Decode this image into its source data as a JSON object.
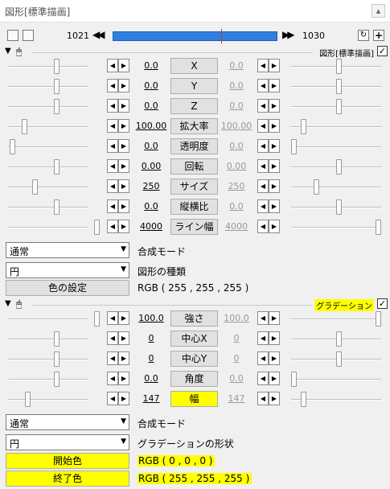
{
  "window": {
    "title": "図形[標準描画]",
    "close_glyph": "▴"
  },
  "toolbar": {
    "frame_start": "1021",
    "frame_end": "1030",
    "seek_fraction": 0.66
  },
  "section1": {
    "name": "図形[標準描画]",
    "checked": "✓"
  },
  "params1": [
    {
      "label": "X",
      "value": "0.0",
      "end": "0.0",
      "highlight": false
    },
    {
      "label": "Y",
      "value": "0.0",
      "end": "0.0",
      "highlight": false
    },
    {
      "label": "Z",
      "value": "0.0",
      "end": "0.0",
      "highlight": false
    },
    {
      "label": "拡大率",
      "value": "100.00",
      "end": "100.00",
      "highlight": false
    },
    {
      "label": "透明度",
      "value": "0.0",
      "end": "0.0",
      "highlight": false
    },
    {
      "label": "回転",
      "value": "0.00",
      "end": "0.00",
      "highlight": false
    },
    {
      "label": "サイズ",
      "value": "250",
      "end": "250",
      "highlight": false
    },
    {
      "label": "縦横比",
      "value": "0.0",
      "end": "0.0",
      "highlight": false
    },
    {
      "label": "ライン幅",
      "value": "4000",
      "end": "4000",
      "highlight": false
    }
  ],
  "blend1": {
    "value": "通常",
    "label": "合成モード"
  },
  "shape1": {
    "value": "円",
    "label": "図形の種類"
  },
  "color_btn": {
    "label": "色の設定",
    "value": "RGB ( 255 , 255 , 255 )"
  },
  "section2": {
    "name": "グラデーション",
    "checked": "✓"
  },
  "params2": [
    {
      "label": "強さ",
      "value": "100.0",
      "end": "100.0",
      "highlight": false
    },
    {
      "label": "中心X",
      "value": "0",
      "end": "0",
      "highlight": false
    },
    {
      "label": "中心Y",
      "value": "0",
      "end": "0",
      "highlight": false
    },
    {
      "label": "角度",
      "value": "0.0",
      "end": "0.0",
      "highlight": false
    },
    {
      "label": "幅",
      "value": "147",
      "end": "147",
      "highlight": true
    }
  ],
  "blend2": {
    "value": "通常",
    "label": "合成モード"
  },
  "shape2": {
    "value": "円",
    "label": "グラデーションの形状"
  },
  "start_color": {
    "label": "開始色",
    "value": "RGB ( 0 , 0 , 0 )"
  },
  "end_color": {
    "label": "終了色",
    "value": "RGB ( 255 , 255 , 255 )"
  },
  "colors": {
    "highlight": "#ffff00",
    "seekbar": "#2f7fe0"
  }
}
